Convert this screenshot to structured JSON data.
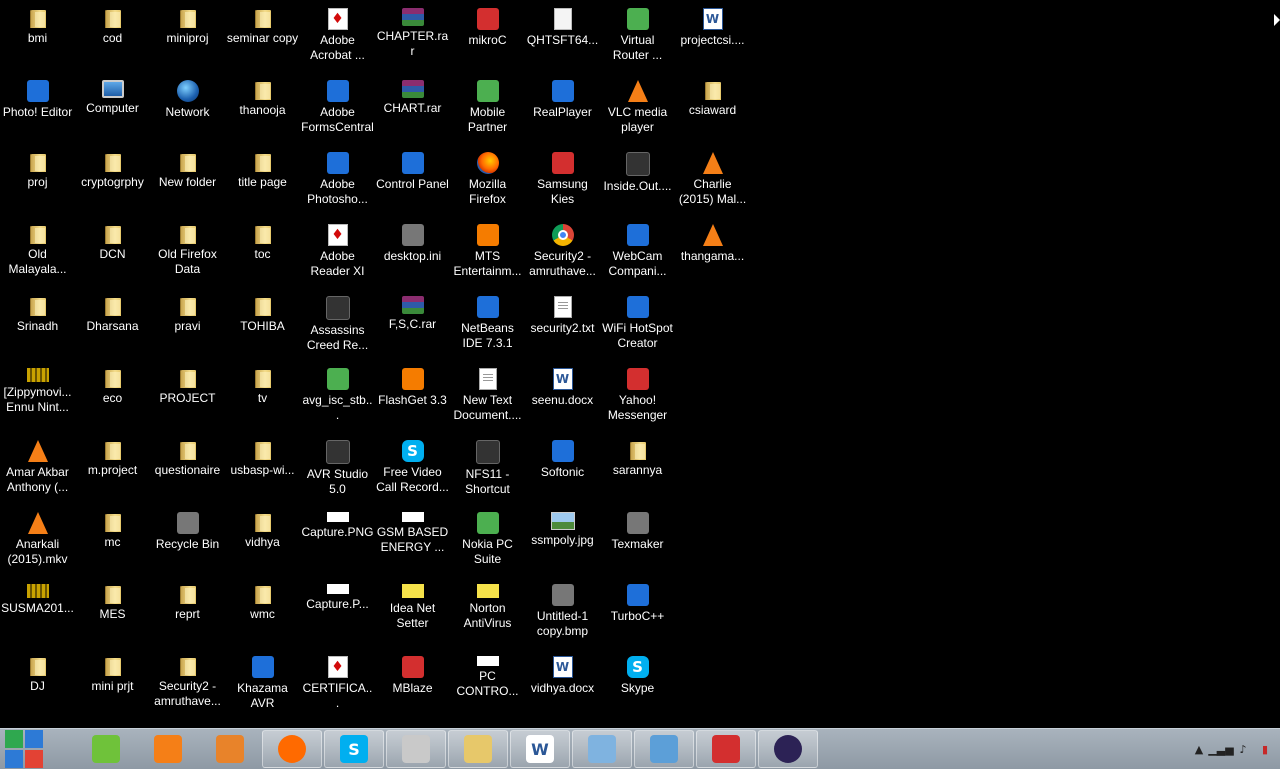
{
  "desktop": {
    "icons": [
      {
        "label": "bmi",
        "icon": "folder"
      },
      {
        "label": "Photo! Editor",
        "icon": "photo-editor"
      },
      {
        "label": "proj",
        "icon": "folder"
      },
      {
        "label": "Old Malayala...",
        "icon": "folder"
      },
      {
        "label": "Srinadh",
        "icon": "folder"
      },
      {
        "label": "[Zippymovi... Ennu Nint...",
        "icon": "video-file"
      },
      {
        "label": "Amar Akbar Anthony (...",
        "icon": "vlc"
      },
      {
        "label": "Anarkali (2015).mkv",
        "icon": "vlc"
      },
      {
        "label": "SUSMA201...",
        "icon": "video-file"
      },
      {
        "label": "DJ",
        "icon": "folder"
      },
      {
        "label": "cod",
        "icon": "folder"
      },
      {
        "label": "Computer",
        "icon": "computer"
      },
      {
        "label": "cryptogrphy",
        "icon": "folder"
      },
      {
        "label": "DCN",
        "icon": "folder"
      },
      {
        "label": "Dharsana",
        "icon": "folder"
      },
      {
        "label": "eco",
        "icon": "folder"
      },
      {
        "label": "m.project",
        "icon": "folder"
      },
      {
        "label": "mc",
        "icon": "folder"
      },
      {
        "label": "MES",
        "icon": "folder"
      },
      {
        "label": "mini prjt",
        "icon": "folder"
      },
      {
        "label": "miniproj",
        "icon": "folder"
      },
      {
        "label": "Network",
        "icon": "network"
      },
      {
        "label": "New folder",
        "icon": "folder"
      },
      {
        "label": "Old Firefox Data",
        "icon": "folder"
      },
      {
        "label": "pravi",
        "icon": "folder"
      },
      {
        "label": "PROJECT",
        "icon": "folder"
      },
      {
        "label": "questionaire",
        "icon": "folder"
      },
      {
        "label": "Recycle Bin",
        "icon": "recycle-bin"
      },
      {
        "label": "reprt",
        "icon": "folder"
      },
      {
        "label": "Security2 - amruthave...",
        "icon": "folder"
      },
      {
        "label": "seminar copy",
        "icon": "folder"
      },
      {
        "label": "thanooja",
        "icon": "folder"
      },
      {
        "label": "title page",
        "icon": "folder"
      },
      {
        "label": "toc",
        "icon": "folder"
      },
      {
        "label": "TOHIBA",
        "icon": "folder"
      },
      {
        "label": "tv",
        "icon": "folder"
      },
      {
        "label": "usbasp-wi...",
        "icon": "folder"
      },
      {
        "label": "vidhya",
        "icon": "folder"
      },
      {
        "label": "wmc",
        "icon": "folder"
      },
      {
        "label": "Khazama AVR Progra...",
        "icon": "khazama"
      },
      {
        "label": "Adobe Acrobat ...",
        "icon": "pdf"
      },
      {
        "label": "Adobe FormsCentral",
        "icon": "forms"
      },
      {
        "label": "Adobe Photosho...",
        "icon": "photoshop"
      },
      {
        "label": "Adobe Reader XI",
        "icon": "pdf"
      },
      {
        "label": "Assassins Creed Re...",
        "icon": "game"
      },
      {
        "label": "avg_isc_stb...",
        "icon": "avg"
      },
      {
        "label": "AVR Studio 5.0",
        "icon": "avr"
      },
      {
        "label": "Capture.PNG",
        "icon": "image-white"
      },
      {
        "label": "Capture.P...",
        "icon": "image-white"
      },
      {
        "label": "CERTIFICA...",
        "icon": "pdf"
      },
      {
        "label": "CHAPTER.rar",
        "icon": "rar"
      },
      {
        "label": "CHART.rar",
        "icon": "rar"
      },
      {
        "label": "Control Panel",
        "icon": "control-panel"
      },
      {
        "label": "desktop.ini",
        "icon": "settings-file"
      },
      {
        "label": "F,S,C.rar",
        "icon": "rar"
      },
      {
        "label": "FlashGet 3.3",
        "icon": "flashget"
      },
      {
        "label": "Free Video Call Record...",
        "icon": "skype"
      },
      {
        "label": "GSM BASED ENERGY ...",
        "icon": "image-white"
      },
      {
        "label": "Idea Net Setter",
        "icon": "idea"
      },
      {
        "label": "MBlaze",
        "icon": "mblaze"
      },
      {
        "label": "mikroC",
        "icon": "mikroc"
      },
      {
        "label": "Mobile Partner",
        "icon": "mobile-partner"
      },
      {
        "label": "Mozilla Firefox",
        "icon": "firefox"
      },
      {
        "label": "MTS Entertainm...",
        "icon": "film"
      },
      {
        "label": "NetBeans IDE 7.3.1",
        "icon": "netbeans"
      },
      {
        "label": "New Text Document....",
        "icon": "text-file"
      },
      {
        "label": "NFS11 - Shortcut",
        "icon": "nfs"
      },
      {
        "label": "Nokia PC Suite",
        "icon": "nokia"
      },
      {
        "label": "Norton AntiVirus",
        "icon": "norton"
      },
      {
        "label": "PC CONTRO...",
        "icon": "image-white"
      },
      {
        "label": "QHTSFT64...",
        "icon": "generic-file"
      },
      {
        "label": "RealPlayer",
        "icon": "realplayer"
      },
      {
        "label": "Samsung Kies",
        "icon": "kies"
      },
      {
        "label": "Security2 - amruthave...",
        "icon": "chrome"
      },
      {
        "label": "security2.txt",
        "icon": "text-file"
      },
      {
        "label": "seenu.docx",
        "icon": "word"
      },
      {
        "label": "Softonic",
        "icon": "softonic"
      },
      {
        "label": "ssmpoly.jpg",
        "icon": "image"
      },
      {
        "label": "Untitled-1 copy.bmp",
        "icon": "image-gray"
      },
      {
        "label": "vidhya.docx",
        "icon": "word"
      },
      {
        "label": "Virtual Router ...",
        "icon": "virtual-router"
      },
      {
        "label": "VLC media player",
        "icon": "vlc"
      },
      {
        "label": "Inside.Out....",
        "icon": "video-dark"
      },
      {
        "label": "WebCam Compani...",
        "icon": "webcam"
      },
      {
        "label": "WiFi HotSpot Creator",
        "icon": "wifi"
      },
      {
        "label": "Yahoo! Messenger",
        "icon": "yahoo"
      },
      {
        "label": "sarannya",
        "icon": "folder"
      },
      {
        "label": "Texmaker",
        "icon": "texmaker"
      },
      {
        "label": "TurboC++",
        "icon": "turboc"
      },
      {
        "label": "Skype",
        "icon": "skype"
      },
      {
        "label": "projectcsi....",
        "icon": "word"
      },
      {
        "label": "csiaward",
        "icon": "folder"
      },
      {
        "label": "Charlie (2015) Mal...",
        "icon": "vlc"
      },
      {
        "label": "thangama...",
        "icon": "vlc"
      }
    ]
  },
  "taskbar": {
    "start_icon": "windows-logo-icon",
    "pinned": [
      {
        "name": "smiley-app",
        "icon": "smiley-icon",
        "color": "#6fc23a",
        "active": false
      },
      {
        "name": "vlc",
        "icon": "vlc-icon",
        "color": "#f57f17",
        "active": false
      },
      {
        "name": "media-player",
        "icon": "media-player-icon",
        "color": "#e8832a",
        "active": false
      },
      {
        "name": "firefox",
        "icon": "firefox-icon",
        "color": "#ff6a00",
        "active": true
      },
      {
        "name": "skype",
        "icon": "skype-icon",
        "color": "#00aff0",
        "active": true
      },
      {
        "name": "texmaker",
        "icon": "texmaker-icon",
        "color": "#c9c9c9",
        "active": true
      },
      {
        "name": "file-explorer",
        "icon": "folder-icon",
        "color": "#e7c86a",
        "active": true
      },
      {
        "name": "word",
        "icon": "word-icon",
        "color": "#2b5797",
        "active": true
      },
      {
        "name": "paint",
        "icon": "paint-icon",
        "color": "#7fb3e0",
        "active": true
      },
      {
        "name": "photo-viewer",
        "icon": "photo-icon",
        "color": "#5c9fd8",
        "active": true
      },
      {
        "name": "flashget",
        "icon": "flashget-icon",
        "color": "#d32f2f",
        "active": true
      },
      {
        "name": "eclipse",
        "icon": "eclipse-icon",
        "color": "#2c2255",
        "active": true
      }
    ],
    "tray": [
      "show-hidden-icons-icon",
      "signal-icon",
      "volume-icon",
      "battery-icon"
    ]
  }
}
